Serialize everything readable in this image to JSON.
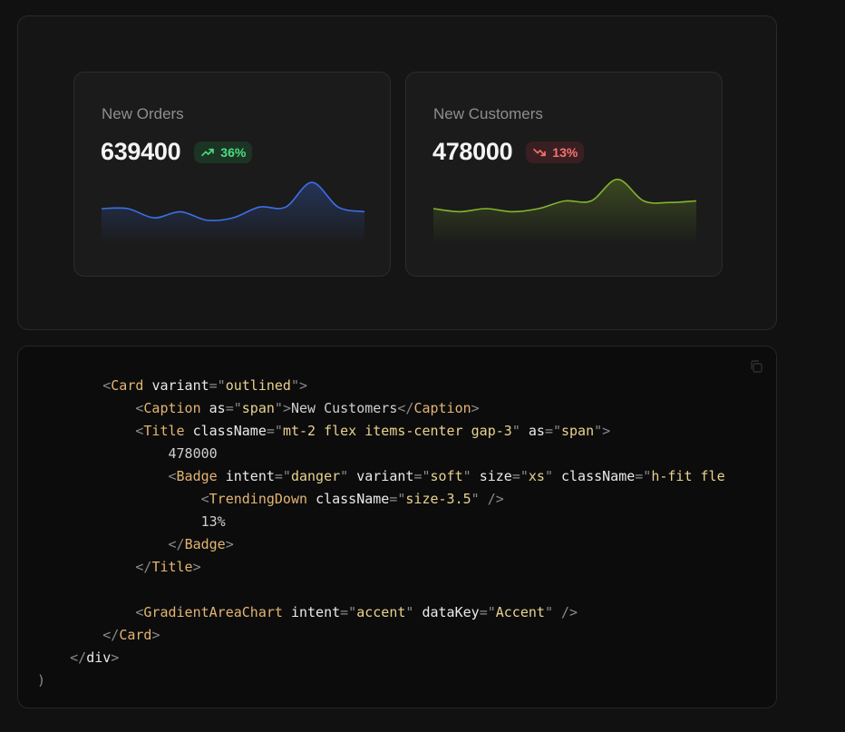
{
  "cards": [
    {
      "caption": "New Orders",
      "value": "639400",
      "badge": "36%",
      "trend": "up",
      "trend_icon": "trending-up-icon",
      "color": "#3b6fe8",
      "series": [
        40,
        40,
        28,
        36,
        25,
        28,
        42,
        42,
        74,
        42,
        36
      ]
    },
    {
      "caption": "New Customers",
      "value": "478000",
      "badge": "13%",
      "trend": "down",
      "trend_icon": "trending-down-icon",
      "color": "#84b42e",
      "series": [
        40,
        36,
        40,
        36,
        40,
        50,
        50,
        78,
        50,
        48,
        50
      ]
    }
  ],
  "code": {
    "copy_icon": "copy-icon",
    "lines": [
      [
        {
          "t": "        ",
          "c": "p"
        },
        {
          "t": "<",
          "c": "p"
        },
        {
          "t": "Card",
          "c": "tg"
        },
        {
          "t": " ",
          "c": "p"
        },
        {
          "t": "variant",
          "c": "at"
        },
        {
          "t": "=\"",
          "c": "p"
        },
        {
          "t": "outlined",
          "c": "sv"
        },
        {
          "t": "\"",
          "c": "p"
        },
        {
          "t": ">",
          "c": "p"
        }
      ],
      [
        {
          "t": "            ",
          "c": "p"
        },
        {
          "t": "<",
          "c": "p"
        },
        {
          "t": "Caption",
          "c": "tg"
        },
        {
          "t": " ",
          "c": "p"
        },
        {
          "t": "as",
          "c": "at"
        },
        {
          "t": "=\"",
          "c": "p"
        },
        {
          "t": "span",
          "c": "sv"
        },
        {
          "t": "\"",
          "c": "p"
        },
        {
          "t": ">",
          "c": "p"
        },
        {
          "t": "New Customers",
          "c": "tx"
        },
        {
          "t": "</",
          "c": "p"
        },
        {
          "t": "Caption",
          "c": "tg"
        },
        {
          "t": ">",
          "c": "p"
        }
      ],
      [
        {
          "t": "            ",
          "c": "p"
        },
        {
          "t": "<",
          "c": "p"
        },
        {
          "t": "Title",
          "c": "tg"
        },
        {
          "t": " ",
          "c": "p"
        },
        {
          "t": "className",
          "c": "at"
        },
        {
          "t": "=\"",
          "c": "p"
        },
        {
          "t": "mt-2 flex items-center gap-3",
          "c": "sv"
        },
        {
          "t": "\"",
          "c": "p"
        },
        {
          "t": " ",
          "c": "p"
        },
        {
          "t": "as",
          "c": "at"
        },
        {
          "t": "=\"",
          "c": "p"
        },
        {
          "t": "span",
          "c": "sv"
        },
        {
          "t": "\"",
          "c": "p"
        },
        {
          "t": ">",
          "c": "p"
        }
      ],
      [
        {
          "t": "                ",
          "c": "p"
        },
        {
          "t": "478000",
          "c": "tx"
        }
      ],
      [
        {
          "t": "                ",
          "c": "p"
        },
        {
          "t": "<",
          "c": "p"
        },
        {
          "t": "Badge",
          "c": "tg"
        },
        {
          "t": " ",
          "c": "p"
        },
        {
          "t": "intent",
          "c": "at"
        },
        {
          "t": "=\"",
          "c": "p"
        },
        {
          "t": "danger",
          "c": "sv"
        },
        {
          "t": "\"",
          "c": "p"
        },
        {
          "t": " ",
          "c": "p"
        },
        {
          "t": "variant",
          "c": "at"
        },
        {
          "t": "=\"",
          "c": "p"
        },
        {
          "t": "soft",
          "c": "sv"
        },
        {
          "t": "\"",
          "c": "p"
        },
        {
          "t": " ",
          "c": "p"
        },
        {
          "t": "size",
          "c": "at"
        },
        {
          "t": "=\"",
          "c": "p"
        },
        {
          "t": "xs",
          "c": "sv"
        },
        {
          "t": "\"",
          "c": "p"
        },
        {
          "t": " ",
          "c": "p"
        },
        {
          "t": "className",
          "c": "at"
        },
        {
          "t": "=\"",
          "c": "p"
        },
        {
          "t": "h-fit fle",
          "c": "sv"
        }
      ],
      [
        {
          "t": "                    ",
          "c": "p"
        },
        {
          "t": "<",
          "c": "p"
        },
        {
          "t": "TrendingDown",
          "c": "tg"
        },
        {
          "t": " ",
          "c": "p"
        },
        {
          "t": "className",
          "c": "at"
        },
        {
          "t": "=\"",
          "c": "p"
        },
        {
          "t": "size-3.5",
          "c": "sv"
        },
        {
          "t": "\"",
          "c": "p"
        },
        {
          "t": " />",
          "c": "p"
        }
      ],
      [
        {
          "t": "                    ",
          "c": "p"
        },
        {
          "t": "13%",
          "c": "tx"
        }
      ],
      [
        {
          "t": "                ",
          "c": "p"
        },
        {
          "t": "</",
          "c": "p"
        },
        {
          "t": "Badge",
          "c": "tg"
        },
        {
          "t": ">",
          "c": "p"
        }
      ],
      [
        {
          "t": "            ",
          "c": "p"
        },
        {
          "t": "</",
          "c": "p"
        },
        {
          "t": "Title",
          "c": "tg"
        },
        {
          "t": ">",
          "c": "p"
        }
      ],
      [
        {
          "t": "",
          "c": "p"
        }
      ],
      [
        {
          "t": "            ",
          "c": "p"
        },
        {
          "t": "<",
          "c": "p"
        },
        {
          "t": "GradientAreaChart",
          "c": "tg"
        },
        {
          "t": " ",
          "c": "p"
        },
        {
          "t": "intent",
          "c": "at"
        },
        {
          "t": "=\"",
          "c": "p"
        },
        {
          "t": "accent",
          "c": "sv"
        },
        {
          "t": "\"",
          "c": "p"
        },
        {
          "t": " ",
          "c": "p"
        },
        {
          "t": "dataKey",
          "c": "at"
        },
        {
          "t": "=\"",
          "c": "p"
        },
        {
          "t": "Accent",
          "c": "sv"
        },
        {
          "t": "\"",
          "c": "p"
        },
        {
          "t": " />",
          "c": "p"
        }
      ],
      [
        {
          "t": "        ",
          "c": "p"
        },
        {
          "t": "</",
          "c": "p"
        },
        {
          "t": "Card",
          "c": "tg"
        },
        {
          "t": ">",
          "c": "p"
        }
      ],
      [
        {
          "t": "    ",
          "c": "p"
        },
        {
          "t": "</",
          "c": "p"
        },
        {
          "t": "div",
          "c": "at"
        },
        {
          "t": ">",
          "c": "p"
        }
      ],
      [
        {
          "t": ")",
          "c": "p"
        }
      ]
    ]
  }
}
